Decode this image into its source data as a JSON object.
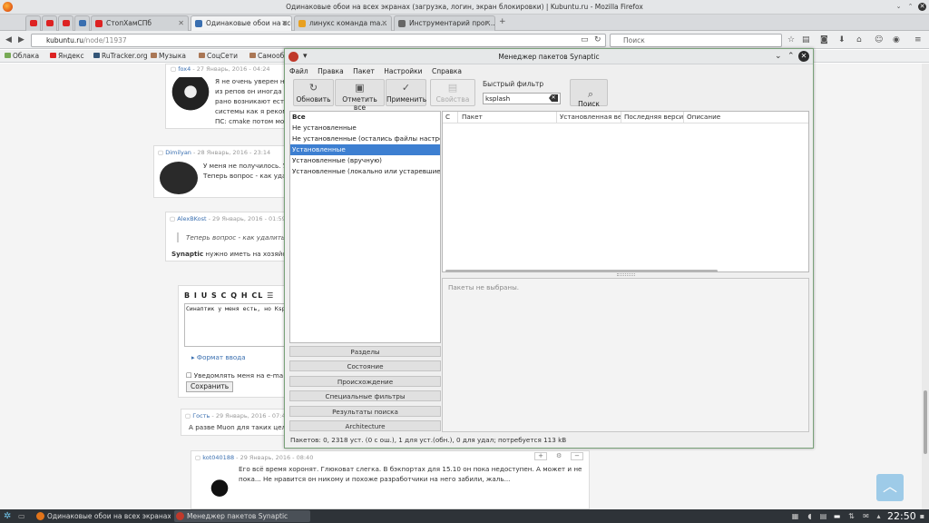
{
  "firefox": {
    "window_title": "Одинаковые обои на всех экранах (загрузка, логин, экран блокировки) | Kubuntu.ru - Mozilla Firefox",
    "tabs": [
      {
        "label": "СтопХамСПб",
        "active": false
      },
      {
        "label": "Одинаковые обои на все...",
        "active": true
      },
      {
        "label": "линукс команда ma...",
        "active": false
      },
      {
        "label": "Инструментарий прог...",
        "active": false
      }
    ],
    "url": {
      "host": "kubuntu.ru",
      "path": "/node/11937"
    },
    "search_placeholder": "Поиск",
    "bookmarks": [
      "Облака",
      "Яндекс",
      "RuTracker.org",
      "Музыка",
      "СоцСети",
      "Самооб"
    ]
  },
  "page": {
    "comments": [
      {
        "author": "fox4",
        "meta": " - 27 Январь, 2016 - 04:24",
        "lines": [
          "Я не очень уверен не",
          "из репов он иногда г",
          "рано возникают ест",
          "системы как я реком",
          "ПС: cmake потом мо"
        ]
      },
      {
        "author": "Dimilyan",
        "meta": " - 28 Январь, 2016 - 23:14",
        "lines": [
          "У меня не получилось. У",
          "Теперь вопрос - как уда"
        ]
      },
      {
        "author": "AlexBKost",
        "meta": " - 29 Январь, 2016 - 01:59",
        "quote": "Теперь вопрос - как удалить",
        "bold": "Synaptic",
        "text": " нужно иметь на хозяйст"
      },
      {
        "author": "Гость",
        "meta": " - 29 Январь, 2016 - 07:48",
        "lines": [
          "А разве Muon для таких целе"
        ]
      },
      {
        "author": "kot040188",
        "meta": " - 29 Январь, 2016 - 08:40",
        "lines": [
          "Его всё время хоронят. Глюковат слегка. В бэкпортах для 15.10 он пока недоступен. А может и не",
          "пока... Не нравится он никому и похоже разработчики на него забили, жаль..."
        ]
      }
    ],
    "editor": {
      "toolbar": [
        "B",
        "I",
        "U",
        "S",
        "C",
        "Q",
        "H",
        "CL",
        "☰"
      ],
      "text": "Синаптик у меня есть, но Ksplash",
      "format_link": "Формат ввода",
      "notify_label": "Уведомлять меня на e-ma",
      "save_label": "Сохранить"
    }
  },
  "synaptic": {
    "title": "Менеджер пакетов Synaptic",
    "menu": [
      "Файл",
      "Правка",
      "Пакет",
      "Настройки",
      "Справка"
    ],
    "toolbar": {
      "refresh": "Обновить",
      "mark_all": "Отметить все",
      "apply": "Применить",
      "properties": "Свойства",
      "search": "Поиск"
    },
    "quick_filter": {
      "label": "Быстрый фильтр",
      "value": "ksplash"
    },
    "filters": [
      {
        "label": "Все",
        "selected": false,
        "bold": true
      },
      {
        "label": "Не установленные",
        "selected": false
      },
      {
        "label": "Не установленные (остались файлы настроек)",
        "selected": false
      },
      {
        "label": "Установленные",
        "selected": true
      },
      {
        "label": "Установленные (вручную)",
        "selected": false
      },
      {
        "label": "Установленные (локально или устаревшие)",
        "selected": false
      }
    ],
    "categories": [
      "Разделы",
      "Состояние",
      "Происхождение",
      "Специальные фильтры",
      "Результаты поиска",
      "Architecture"
    ],
    "columns": [
      "С",
      "Пакет",
      "Установленная версия",
      "Последняя версия",
      "Описание"
    ],
    "description_placeholder": "Пакеты не выбраны.",
    "status": "Пакетов: 0, 2318 уст. (0 с ош.), 1 для уст.(обн.), 0 для удал; потребуется 113 kB"
  },
  "taskbar": {
    "tasks": [
      {
        "label": "Одинаковые обои на всех экранах (",
        "active": false
      },
      {
        "label": "Менеджер пакетов Synaptic",
        "active": true
      }
    ],
    "clock": "22:50"
  },
  "colors": {
    "selection": "#3d7fd1",
    "link": "#3a6fb0",
    "taskbar": "#2e3338"
  }
}
